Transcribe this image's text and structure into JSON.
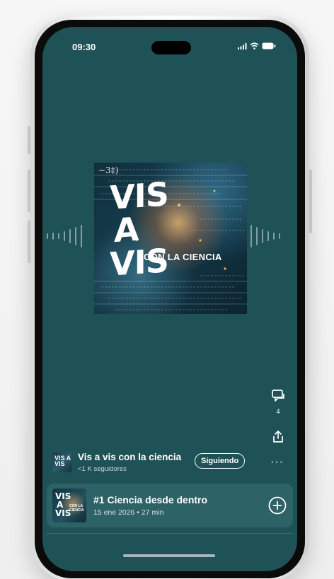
{
  "status_bar": {
    "time": "09:30"
  },
  "cover": {
    "line1": "VIS",
    "line2": "A",
    "line3": "VIS",
    "subtitle": "CON LA CIENCIA",
    "formula": "−3‡)"
  },
  "actions": {
    "comments_icon": "comment-icon",
    "comments_count": "4",
    "share_icon": "share-icon",
    "more_icon": "more-icon",
    "more_label": "···"
  },
  "show": {
    "title": "Vis a vis con la ciencia",
    "followers": "<1 K seguidores",
    "follow_button": "Siguiendo",
    "thumb_text": "VIS A VIS"
  },
  "episode": {
    "title": "#1 Ciencia desde dentro",
    "meta": "15 ene 2026 • 27 min",
    "thumb_v1": "VIS",
    "thumb_v2": "A",
    "thumb_v3": "VIS",
    "thumb_sub": "CON LA CIENCIA",
    "add_icon": "add-circle-icon"
  },
  "colors": {
    "background": "#1f5256",
    "card": "#2d6266",
    "text": "#ffffff"
  }
}
